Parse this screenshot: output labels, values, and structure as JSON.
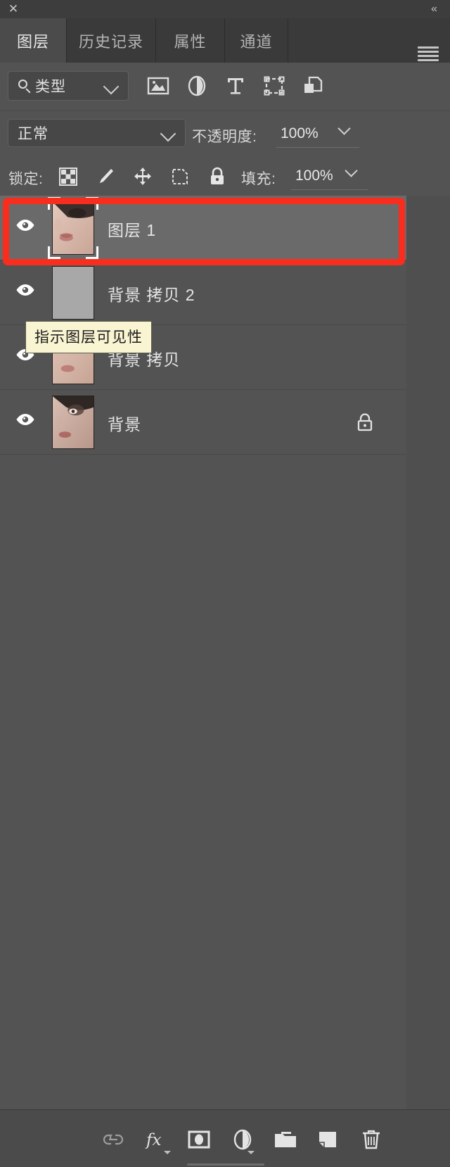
{
  "window": {
    "close_label": "✕",
    "collapse_label": "«",
    "menu_icon": "hamburger-menu-icon"
  },
  "tabs": [
    {
      "label": "图层",
      "active": true
    },
    {
      "label": "历史记录",
      "active": false
    },
    {
      "label": "属性",
      "active": false
    },
    {
      "label": "通道",
      "active": false
    }
  ],
  "filter_bar": {
    "search_icon": "search-icon",
    "kind_label": "类型",
    "dropdown_caret": "chevron-down-icon",
    "filter_icons": [
      "pixel-layer-filter-icon",
      "adjustment-layer-filter-icon",
      "type-layer-filter-icon",
      "shape-layer-filter-icon",
      "smart-object-filter-icon"
    ],
    "toggle": {
      "name": "filter-enable-toggle",
      "state": "off"
    }
  },
  "blend_bar": {
    "blend_mode": "正常",
    "opacity_label": "不透明度:",
    "opacity_value": "100%"
  },
  "lock_bar": {
    "lock_label": "锁定:",
    "lock_icons": [
      "lock-transparent-pixels-icon",
      "lock-image-pixels-icon",
      "lock-position-icon",
      "lock-artboard-nesting-icon",
      "lock-all-icon"
    ],
    "fill_label": "填充:",
    "fill_value": "100%"
  },
  "layers": [
    {
      "name": "图层 1",
      "visible": true,
      "selected": true,
      "locked": false,
      "thumbnail": "portrait-photo-thumbnail",
      "has_selection_brackets": true
    },
    {
      "name": "背景 拷贝 2",
      "visible": true,
      "selected": false,
      "locked": false,
      "thumbnail": "solid-gray-thumbnail",
      "has_selection_brackets": false
    },
    {
      "name": "背景 拷贝",
      "visible": true,
      "selected": false,
      "locked": false,
      "thumbnail": "portrait-photo-thumbnail",
      "has_selection_brackets": false
    },
    {
      "name": "背景",
      "visible": true,
      "selected": false,
      "locked": true,
      "thumbnail": "portrait-photo-thumbnail",
      "has_selection_brackets": false
    }
  ],
  "tooltip": {
    "text": "指示图层可见性"
  },
  "annotation": {
    "type": "red-highlight-rectangle",
    "color": "#f92d1e",
    "targets_layer": "图层 1"
  },
  "bottom_bar": {
    "icons": [
      "link-layers-icon",
      "layer-style-fx-icon",
      "add-layer-mask-icon",
      "new-adjustment-layer-icon",
      "new-group-icon",
      "new-layer-icon",
      "delete-layer-icon"
    ]
  },
  "colors": {
    "panel_bg": "#535353",
    "tab_bg": "#3a3a3a",
    "tab_active_bg": "#4b4b4b",
    "selected_row": "#6a6a6a",
    "annotation_red": "#f92d1e",
    "tooltip_bg": "#f9f5d2"
  }
}
